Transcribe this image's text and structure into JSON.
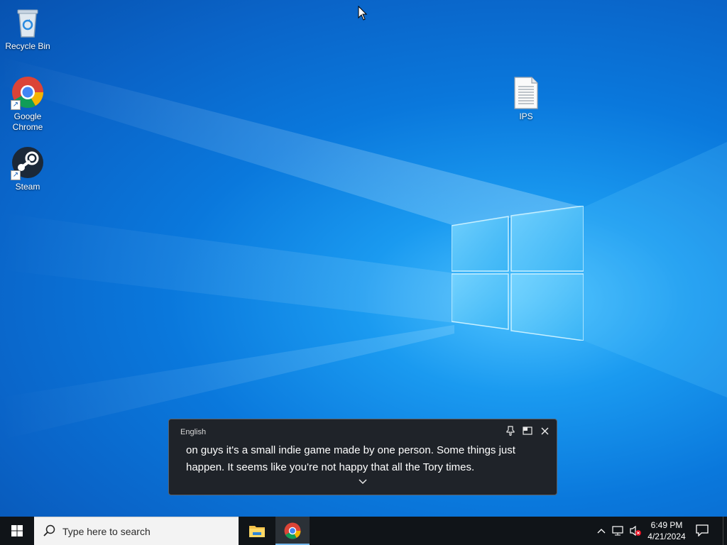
{
  "desktop": {
    "icons": [
      {
        "label": "Recycle Bin",
        "icon": "recycle-bin-icon"
      },
      {
        "label": "Google Chrome",
        "icon": "chrome-icon"
      },
      {
        "label": "Steam",
        "icon": "steam-icon"
      },
      {
        "label": "IPS",
        "icon": "text-document-icon"
      }
    ]
  },
  "live_captions": {
    "language": "English",
    "text": "on guys it's a small indie game made by one person. Some things just happen. It seems like you're not happy that all the Tory times.",
    "buttons": [
      "pin-icon",
      "window-position-icon",
      "close-icon"
    ],
    "expand_icon": "chevron-down-icon"
  },
  "taskbar": {
    "start_icon": "windows-start-icon",
    "search_placeholder": "Type here to search",
    "apps": [
      {
        "name": "File Explorer",
        "icon": "file-explorer-icon",
        "active": false
      },
      {
        "name": "Google Chrome",
        "icon": "chrome-icon",
        "active": true
      }
    ],
    "tray": [
      "chevron-up-icon",
      "network-icon",
      "volume-muted-icon"
    ],
    "time": "6:49 PM",
    "date": "4/21/2024",
    "notification_icon": "action-center-icon"
  },
  "colors": {
    "desktop_blue": "#0a78dc",
    "taskbar": "#101418",
    "captions_bg": "#1f2329",
    "accent": "#76b9ed"
  }
}
